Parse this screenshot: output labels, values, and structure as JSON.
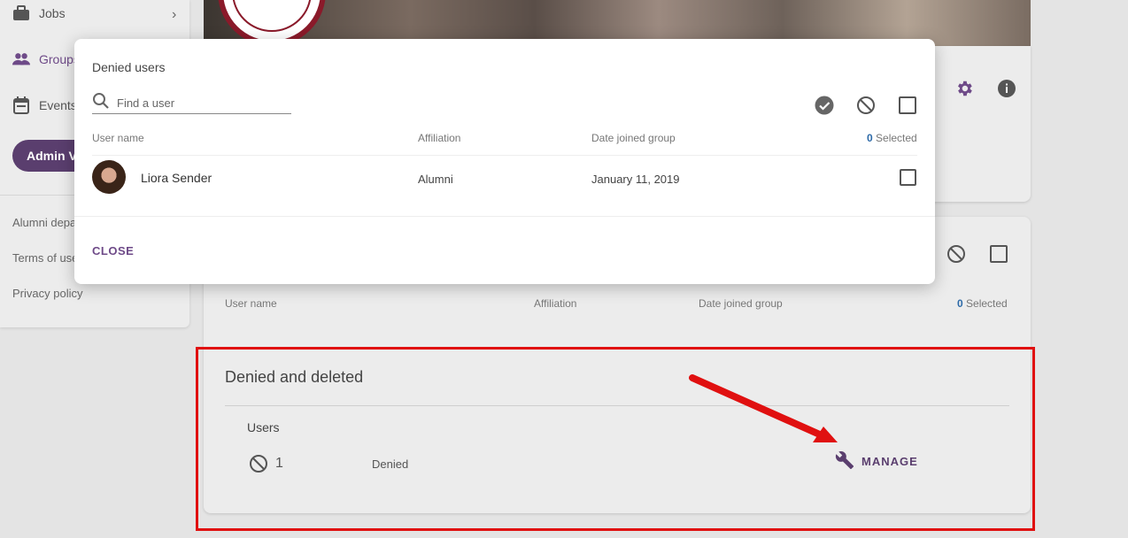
{
  "sidebar": {
    "items": [
      {
        "label": "Jobs",
        "icon": "briefcase-icon"
      },
      {
        "label": "Groups",
        "icon": "people-icon"
      },
      {
        "label": "Events",
        "icon": "calendar-icon"
      }
    ],
    "admin_button": "Admin V",
    "links": [
      "Alumni depa",
      "Terms of use",
      "Privacy policy"
    ]
  },
  "background_table": {
    "columns": [
      "User name",
      "Affiliation",
      "Date joined group"
    ],
    "selected_count": "0",
    "selected_label": "Selected"
  },
  "denied_deleted": {
    "title": "Denied and deleted",
    "users_label": "Users",
    "count": "1",
    "status": "Denied",
    "manage_label": "MANAGE"
  },
  "modal": {
    "title": "Denied users",
    "search_placeholder": "Find a user",
    "columns": {
      "user_name": "User name",
      "affiliation": "Affiliation",
      "date_joined": "Date joined group"
    },
    "selected_count": "0",
    "selected_label": "Selected",
    "rows": [
      {
        "name": "Liora Sender",
        "affiliation": "Alumni",
        "date": "January 11, 2019"
      }
    ],
    "close_label": "CLOSE"
  },
  "colors": {
    "accent": "#6e4a88",
    "highlight": "#e01010",
    "link_blue": "#2d6aa8"
  }
}
